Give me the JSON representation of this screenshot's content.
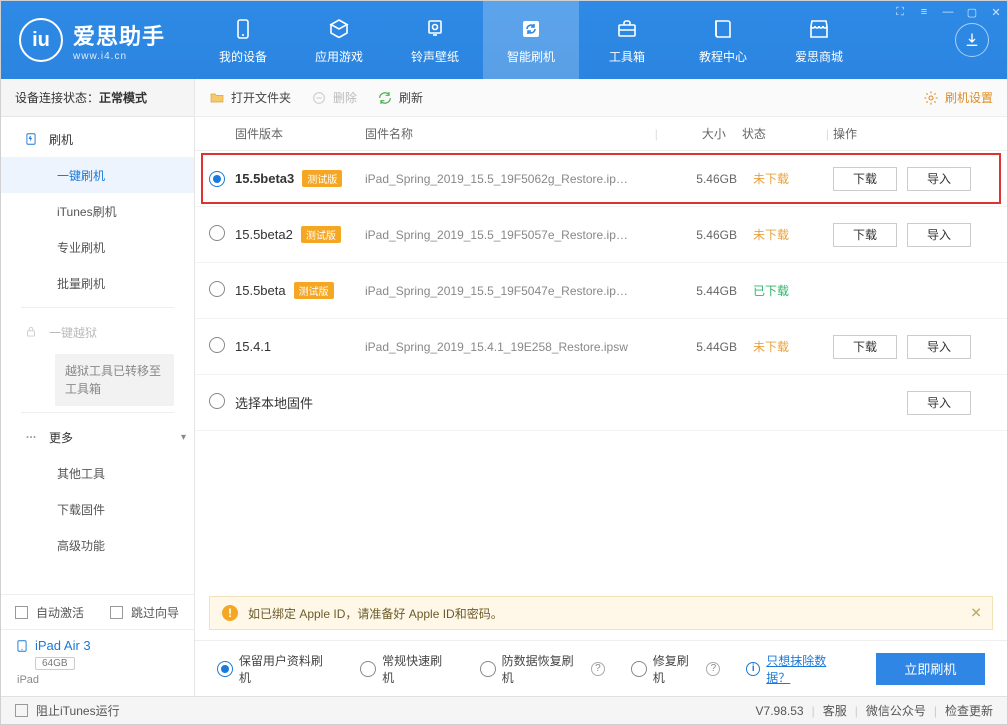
{
  "brand": {
    "name": "爱思助手",
    "url": "www.i4.cn"
  },
  "navs": [
    {
      "id": "device",
      "label": "我的设备",
      "icon": "phone"
    },
    {
      "id": "apps",
      "label": "应用游戏",
      "icon": "apps"
    },
    {
      "id": "ring",
      "label": "铃声壁纸",
      "icon": "music"
    },
    {
      "id": "flash",
      "label": "智能刷机",
      "icon": "refresh",
      "active": true
    },
    {
      "id": "tools",
      "label": "工具箱",
      "icon": "briefcase"
    },
    {
      "id": "tutorial",
      "label": "教程中心",
      "icon": "book"
    },
    {
      "id": "store",
      "label": "爱思商城",
      "icon": "store"
    }
  ],
  "status": {
    "label": "设备连接状态：",
    "value": "正常模式"
  },
  "sidebar": {
    "flash_label": "刷机",
    "oneclick": "一键刷机",
    "itunes": "iTunes刷机",
    "pro": "专业刷机",
    "batch": "批量刷机",
    "jailbreak": "一键越狱",
    "jailbreak_notice": "越狱工具已转移至工具箱",
    "more": "更多",
    "other_tools": "其他工具",
    "download_fw": "下载固件",
    "advanced": "高级功能"
  },
  "auto": {
    "activate": "自动激活",
    "skip": "跳过向导"
  },
  "device": {
    "name": "iPad Air 3",
    "capacity": "64GB",
    "type": "iPad"
  },
  "toolbar": {
    "open": "打开文件夹",
    "delete": "删除",
    "refresh": "刷新",
    "settings": "刷机设置"
  },
  "columns": {
    "version": "固件版本",
    "filename": "固件名称",
    "size": "大小",
    "status": "状态",
    "ops": "操作"
  },
  "buttons": {
    "download": "下载",
    "import": "导入"
  },
  "status_text": {
    "not_downloaded": "未下载",
    "downloaded": "已下载"
  },
  "firmware": [
    {
      "version": "15.5beta3",
      "beta": true,
      "filename": "iPad_Spring_2019_15.5_19F5062g_Restore.ip…",
      "size": "5.46GB",
      "status": "not",
      "selected": true,
      "highlight": true,
      "download": true
    },
    {
      "version": "15.5beta2",
      "beta": true,
      "filename": "iPad_Spring_2019_15.5_19F5057e_Restore.ip…",
      "size": "5.46GB",
      "status": "not",
      "download": true
    },
    {
      "version": "15.5beta",
      "beta": true,
      "filename": "iPad_Spring_2019_15.5_19F5047e_Restore.ip…",
      "size": "5.44GB",
      "status": "done",
      "download": false
    },
    {
      "version": "15.4.1",
      "beta": false,
      "filename": "iPad_Spring_2019_15.4.1_19E258_Restore.ipsw",
      "size": "5.44GB",
      "status": "not",
      "download": true
    }
  ],
  "local_select": "选择本地固件",
  "beta_tag": "测试版",
  "notice": "如已绑定 Apple ID，请准备好 Apple ID和密码。",
  "options": {
    "keep_data": "保留用户资料刷机",
    "normal": "常规快速刷机",
    "anti_loss": "防数据恢复刷机",
    "repair": "修复刷机",
    "wipe_link": "只想抹除数据？",
    "primary": "立即刷机"
  },
  "footer": {
    "block_itunes": "阻止iTunes运行",
    "version": "V7.98.53",
    "support": "客服",
    "wechat": "微信公众号",
    "check_update": "检查更新"
  }
}
